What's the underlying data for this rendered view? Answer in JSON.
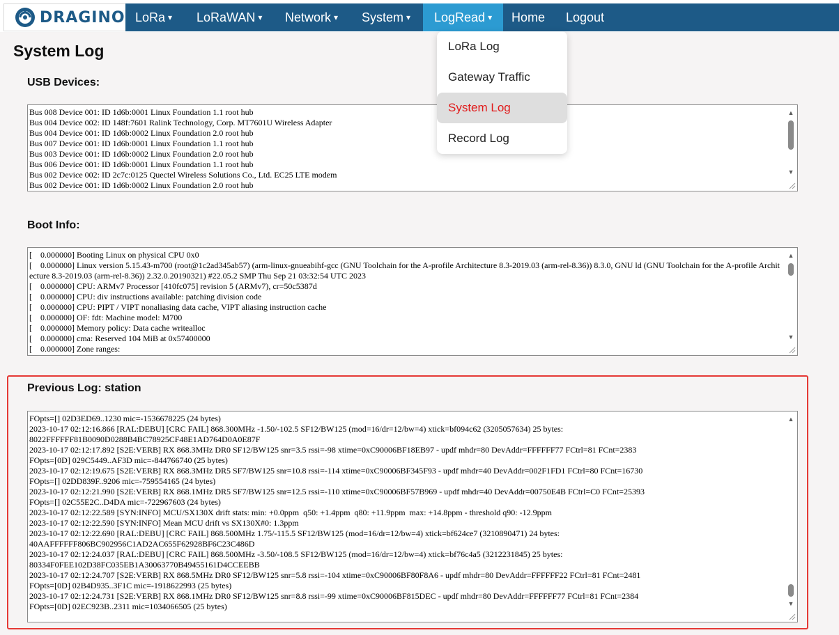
{
  "brand": {
    "name": "DRAGINO",
    "color": "#1d5a87"
  },
  "nav": {
    "items": [
      {
        "label": "LoRa",
        "caret": "▾"
      },
      {
        "label": "LoRaWAN",
        "caret": "▾"
      },
      {
        "label": "Network",
        "caret": "▾"
      },
      {
        "label": "System",
        "caret": "▾"
      },
      {
        "label": "LogRead",
        "caret": "▾",
        "active": true
      },
      {
        "label": "Home"
      },
      {
        "label": "Logout"
      }
    ],
    "bar_color": "#1d5a87",
    "active_color": "#2c9bd2"
  },
  "dropdown": {
    "items": [
      "LoRa Log",
      "Gateway Traffic",
      "System Log",
      "Record Log"
    ],
    "selected": "System Log",
    "selected_color": "#e11b1b"
  },
  "page": {
    "title": "System Log"
  },
  "sections": {
    "usb": {
      "title": "USB Devices:",
      "content": "Bus 008 Device 001: ID 1d6b:0001 Linux Foundation 1.1 root hub\nBus 004 Device 002: ID 148f:7601 Ralink Technology, Corp. MT7601U Wireless Adapter\nBus 004 Device 001: ID 1d6b:0002 Linux Foundation 2.0 root hub\nBus 007 Device 001: ID 1d6b:0001 Linux Foundation 1.1 root hub\nBus 003 Device 001: ID 1d6b:0002 Linux Foundation 2.0 root hub\nBus 006 Device 001: ID 1d6b:0001 Linux Foundation 1.1 root hub\nBus 002 Device 002: ID 2c7c:0125 Quectel Wireless Solutions Co., Ltd. EC25 LTE modem\nBus 002 Device 001: ID 1d6b:0002 Linux Foundation 2.0 root hub"
    },
    "boot": {
      "title": "Boot Info:",
      "content": "[    0.000000] Booting Linux on physical CPU 0x0\n[    0.000000] Linux version 5.15.43-m700 (root@1c2ad345ab57) (arm-linux-gnueabihf-gcc (GNU Toolchain for the A-profile Architecture 8.3-2019.03 (arm-rel-8.36)) 8.3.0, GNU ld (GNU Toolchain for the A-profile Architecture 8.3-2019.03 (arm-rel-8.36)) 2.32.0.20190321) #22.05.2 SMP Thu Sep 21 03:32:54 UTC 2023\n[    0.000000] CPU: ARMv7 Processor [410fc075] revision 5 (ARMv7), cr=50c5387d\n[    0.000000] CPU: div instructions available: patching division code\n[    0.000000] CPU: PIPT / VIPT nonaliasing data cache, VIPT aliasing instruction cache\n[    0.000000] OF: fdt: Machine model: M700\n[    0.000000] Memory policy: Data cache writealloc\n[    0.000000] cma: Reserved 104 MiB at 0x57400000\n[    0.000000] Zone ranges:"
    },
    "previous": {
      "title": "Previous Log: station",
      "content": "FOpts=[] 02D3ED69..1230 mic=-1536678225 (24 bytes)\n2023-10-17 02:12:16.866 [RAL:DEBU] [CRC FAIL] 868.300MHz -1.50/-102.5 SF12/BW125 (mod=16/dr=12/bw=4) xtick=bf094c62 (3205057634) 25 bytes:\n8022FFFFFF81B0090D0288B4BC78925CF48E1AD764D0A0E87F\n2023-10-17 02:12:17.892 [S2E:VERB] RX 868.3MHz DR0 SF12/BW125 snr=3.5 rssi=-98 xtime=0xC90006BF18EB97 - updf mhdr=80 DevAddr=FFFFFF77 FCtrl=81 FCnt=2383\nFOpts=[0D] 029C5449..AF3D mic=-844766740 (25 bytes)\n2023-10-17 02:12:19.675 [S2E:VERB] RX 868.3MHz DR5 SF7/BW125 snr=10.8 rssi=-114 xtime=0xC90006BF345F93 - updf mhdr=40 DevAddr=002F1FD1 FCtrl=80 FCnt=16730\nFOpts=[] 02DD839F..9206 mic=-759554165 (24 bytes)\n2023-10-17 02:12:21.990 [S2E:VERB] RX 868.1MHz DR5 SF7/BW125 snr=12.5 rssi=-110 xtime=0xC90006BF57B969 - updf mhdr=40 DevAddr=00750E4B FCtrl=C0 FCnt=25393\nFOpts=[] 02C55E2C..D4DA mic=-722967603 (24 bytes)\n2023-10-17 02:12:22.589 [SYN:INFO] MCU/SX130X drift stats: min: +0.0ppm  q50: +1.4ppm  q80: +11.9ppm  max: +14.8ppm - threshold q90: -12.9ppm\n2023-10-17 02:12:22.590 [SYN:INFO] Mean MCU drift vs SX130X#0: 1.3ppm\n2023-10-17 02:12:22.690 [RAL:DEBU] [CRC FAIL] 868.500MHz 1.75/-115.5 SF12/BW125 (mod=16/dr=12/bw=4) xtick=bf624ce7 (3210890471) 24 bytes:\n40AAFFFFFF806BC902956C1AD2AC655F62928BF6C23C486D\n2023-10-17 02:12:24.037 [RAL:DEBU] [CRC FAIL] 868.500MHz -3.50/-108.5 SF12/BW125 (mod=16/dr=12/bw=4) xtick=bf76c4a5 (3212231845) 25 bytes:\n80334F0FEE102D38FC035EB1A30063770B49455161D4CCEEBB\n2023-10-17 02:12:24.707 [S2E:VERB] RX 868.5MHz DR0 SF12/BW125 snr=5.8 rssi=-104 xtime=0xC90006BF80F8A6 - updf mhdr=80 DevAddr=FFFFFF22 FCtrl=81 FCnt=2481\nFOpts=[0D] 02B4D935..3F1C mic=-1918622993 (25 bytes)\n2023-10-17 02:12:24.731 [S2E:VERB] RX 868.1MHz DR0 SF12/BW125 snr=8.8 rssi=-99 xtime=0xC90006BF815DEC - updf mhdr=80 DevAddr=FFFFFF77 FCtrl=81 FCnt=2384\nFOpts=[0D] 02EC923B..2311 mic=1034066505 (25 bytes)"
    }
  },
  "icons": {
    "scroll_up": "▲",
    "scroll_down": "▼",
    "logo": "dragino-logo-icon",
    "resize": "resize-grip-icon"
  },
  "highlight_color": "#e53935"
}
